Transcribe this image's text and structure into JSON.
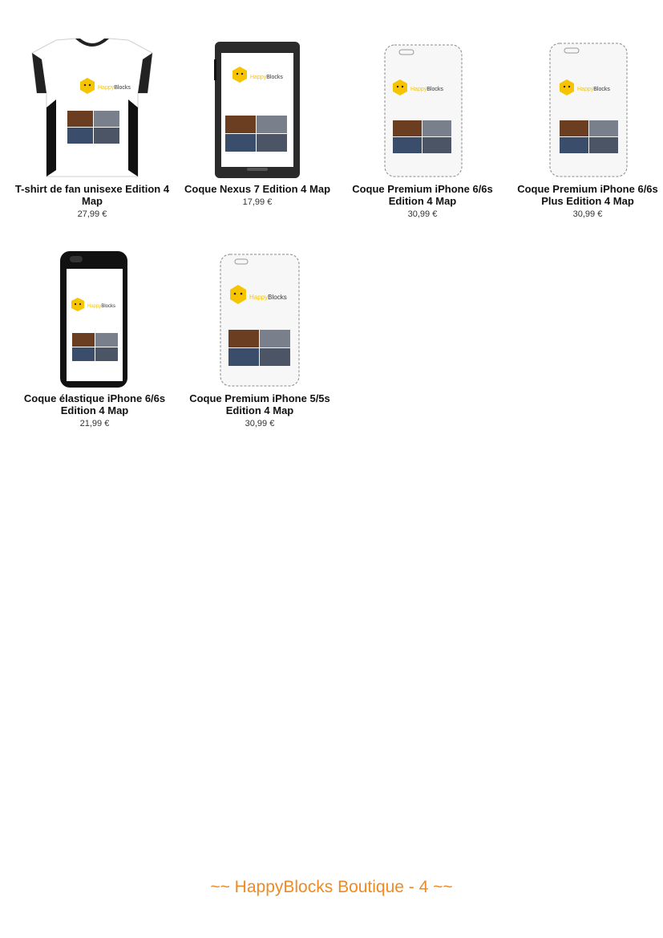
{
  "products": [
    {
      "name": "T-shirt de fan unisexe Edition 4 Map",
      "price": "27,99 €",
      "type": "tshirt"
    },
    {
      "name": "Coque Nexus 7 Edition 4 Map",
      "price": "17,99 €",
      "type": "tablet"
    },
    {
      "name": "Coque Premium iPhone 6/6s Edition 4 Map",
      "price": "30,99 €",
      "type": "phone-premium"
    },
    {
      "name": "Coque Premium iPhone 6/6s Plus Edition 4 Map",
      "price": "30,99 €",
      "type": "phone-premium"
    },
    {
      "name": "Coque élastique iPhone 6/6s Edition 4 Map",
      "price": "21,99 €",
      "type": "phone-black"
    },
    {
      "name": "Coque Premium iPhone 5/5s Edition 4 Map",
      "price": "30,99 €",
      "type": "phone-premium"
    }
  ],
  "logo_text_a": "Happy",
  "logo_text_b": "Blocks",
  "footer": {
    "text": "~~ HappyBlocks Boutique - 4 ~~"
  },
  "colors": {
    "accent": "#f08a24",
    "logo_yellow": "#f6c400"
  }
}
